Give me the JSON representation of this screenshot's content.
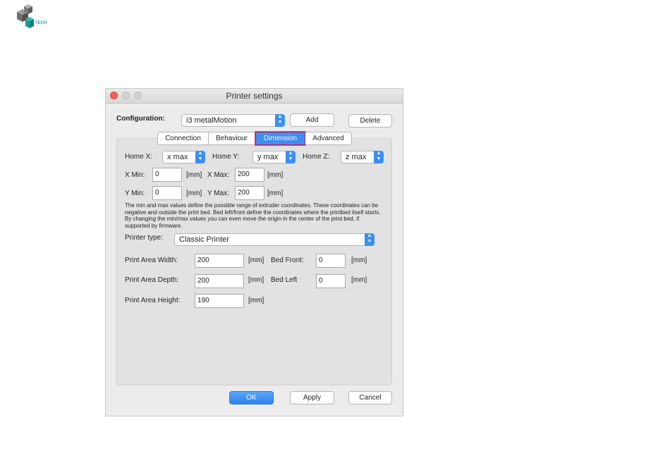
{
  "logo": {
    "text": "TECH"
  },
  "window": {
    "title": "Printer settings",
    "configuration": {
      "label": "Configuration:",
      "selected": "i3 metalMotion",
      "add_label": "Add",
      "delete_label": "Delete"
    },
    "tabs": [
      {
        "label": "Connection",
        "active": false
      },
      {
        "label": "Behaviour",
        "active": false
      },
      {
        "label": "Dimension",
        "active": true
      },
      {
        "label": "Advanced",
        "active": false
      }
    ],
    "home": {
      "x_label": "Home X:",
      "x_value": "x max",
      "y_label": "Home Y:",
      "y_value": "y max",
      "z_label": "Home Z:",
      "z_value": "z max"
    },
    "limits": {
      "x_min_label": "X Min:",
      "x_min": "0",
      "x_max_label": "X Max:",
      "x_max": "200",
      "y_min_label": "Y Min:",
      "y_min": "0",
      "y_max_label": "Y Max:",
      "y_max": "200",
      "unit": "[mm]"
    },
    "description": "The min and max values define the possible range of extruder coordinates. These coordinates can be negative and outside the print bed. Bed left/front define the coordinates where the printbed itself starts. By changing the min/max values you can even move the origin in the center of the print bed, if supported by firmware.",
    "printer_type": {
      "label": "Printer type:",
      "value": "Classic Printer"
    },
    "area": {
      "width_label": "Print Area Width:",
      "width": "200",
      "depth_label": "Print Area Depth:",
      "depth": "200",
      "height_label": "Print Area Height:",
      "height": "190",
      "bed_front_label": "Bed Front:",
      "bed_front": "0",
      "bed_left_label": "Bed Left",
      "bed_left": "0",
      "unit": "[mm]"
    },
    "buttons": {
      "ok": "OK",
      "apply": "Apply",
      "cancel": "Cancel"
    }
  }
}
